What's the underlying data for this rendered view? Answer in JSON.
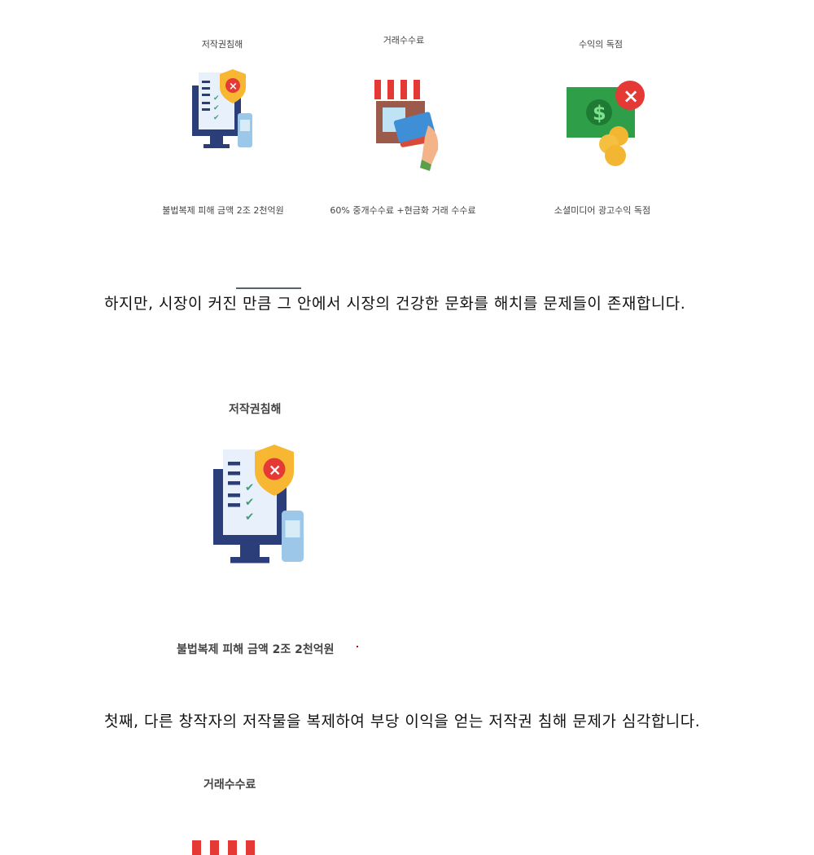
{
  "top_row": [
    {
      "title": "저작권침해",
      "caption": "불법복제 피해 금액 2조 2천억원",
      "icon": "copyright-violation-icon"
    },
    {
      "title": "거래수수료",
      "caption": "60% 중개수수료 +현금화 거래 수수료",
      "icon": "store-card-icon"
    },
    {
      "title": "수익의 독점",
      "caption": "소셜미디어 광고수익 독점",
      "icon": "money-x-icon"
    }
  ],
  "para1": "하지만, 시장이 커진 만큼 그 안에서 시장의 건강한 문화를 해치를 문제들이 존재합니다.",
  "section1": {
    "title": "저작권침해",
    "caption": "불법복제 피해 금액 2조 2천억원"
  },
  "para2": "첫째, 다른 창작자의 저작물을 복제하여 부당 이익을 얻는 저작권 침해 문제가 심각합니다.",
  "section2": {
    "title": "거래수수료"
  }
}
